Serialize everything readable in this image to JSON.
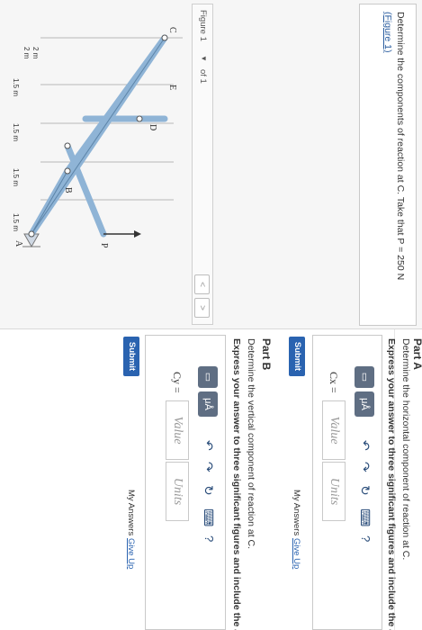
{
  "problem": {
    "text": "Determine the components of reaction at C. Take that P = 250 N",
    "figure_link": "(Figure 1)"
  },
  "figure_nav": {
    "label": "Figure 1",
    "dropdown_arrow": "▼",
    "of_text": "of 1",
    "prev": "<",
    "next": ">"
  },
  "figure": {
    "labels": {
      "A": "A",
      "B": "B",
      "C": "C",
      "D": "D",
      "E": "E",
      "P": "P"
    },
    "dims": {
      "v1": "2 m",
      "v2": "2 m",
      "h1": "1.5 m",
      "h2": "1.5 m",
      "h3": "1.5 m",
      "h4": "1.5 m"
    }
  },
  "part_a": {
    "title": "Part A",
    "description": "Determine the horizontal component of reaction at C.",
    "instruction": "Express your answer to three significant figures and include the appr",
    "variable": "Cx =",
    "value_placeholder": "Value",
    "units_placeholder": "Units",
    "submit": "Submit",
    "my_answers": "My Answers",
    "give_up": "Give Up"
  },
  "part_b": {
    "title": "Part B",
    "description": "Determine the vertical component of reaction at C.",
    "instruction": "Express your answer to three significant figures and include the appro",
    "variable": "Cy =",
    "value_placeholder": "Value",
    "units_placeholder": "Units",
    "submit": "Submit",
    "my_answers": "My Answers",
    "give_up": "Give Up"
  },
  "toolbar": {
    "templates": "▭",
    "mu": "μÅ",
    "undo": "↶",
    "redo": "↷",
    "reset": "↻",
    "keyboard": "⌨",
    "help": "?"
  }
}
